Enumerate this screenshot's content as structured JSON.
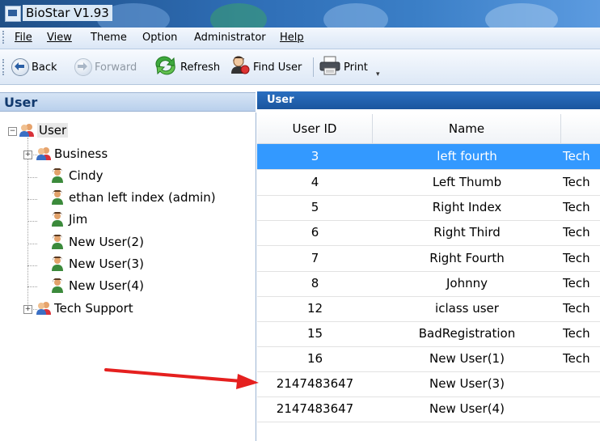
{
  "window": {
    "title": "BioStar V1.93"
  },
  "menu": [
    {
      "label": "File",
      "underline": true
    },
    {
      "label": "View",
      "underline": true
    },
    {
      "label": "Theme",
      "underline": false
    },
    {
      "label": "Option",
      "underline": false
    },
    {
      "label": "Administrator",
      "underline": false
    },
    {
      "label": "Help",
      "underline": true
    }
  ],
  "toolbar": {
    "back": "Back",
    "forward": "Forward",
    "refresh": "Refresh",
    "find_user": "Find User",
    "print": "Print"
  },
  "left_panel": {
    "title": "User",
    "tree": {
      "root": "User",
      "children": [
        {
          "label": "Business",
          "type": "group"
        },
        {
          "label": "Cindy",
          "type": "user"
        },
        {
          "label": "ethan left index (admin)",
          "type": "user"
        },
        {
          "label": "Jim",
          "type": "user"
        },
        {
          "label": "New User(2)",
          "type": "user"
        },
        {
          "label": "New User(3)",
          "type": "user"
        },
        {
          "label": "New User(4)",
          "type": "user"
        },
        {
          "label": "Tech Support",
          "type": "group"
        }
      ]
    }
  },
  "right_panel": {
    "title": "User",
    "columns": [
      "User ID",
      "Name",
      ""
    ],
    "rows": [
      {
        "id": "3",
        "name": "left fourth",
        "group": "Tech",
        "selected": true
      },
      {
        "id": "4",
        "name": "Left Thumb",
        "group": "Tech"
      },
      {
        "id": "5",
        "name": "Right Index",
        "group": "Tech"
      },
      {
        "id": "6",
        "name": "Right Third",
        "group": "Tech"
      },
      {
        "id": "7",
        "name": "Right Fourth",
        "group": "Tech"
      },
      {
        "id": "8",
        "name": "Johnny",
        "group": "Tech"
      },
      {
        "id": "12",
        "name": "iclass user",
        "group": "Tech"
      },
      {
        "id": "15",
        "name": "BadRegistration",
        "group": "Tech"
      },
      {
        "id": "16",
        "name": "New User(1)",
        "group": "Tech"
      },
      {
        "id": "2147483647",
        "name": "New User(3)",
        "group": ""
      },
      {
        "id": "2147483647",
        "name": "New User(4)",
        "group": ""
      }
    ]
  },
  "colors": {
    "selection": "#3399ff",
    "header_blue": "#1a559e",
    "annotation_arrow": "#e5201f"
  },
  "icons": {
    "back": "back-arrow-icon",
    "forward": "forward-arrow-icon",
    "refresh": "refresh-icon",
    "find_user": "find-user-icon",
    "print": "printer-icon",
    "user": "user-icon",
    "group": "user-group-icon"
  }
}
